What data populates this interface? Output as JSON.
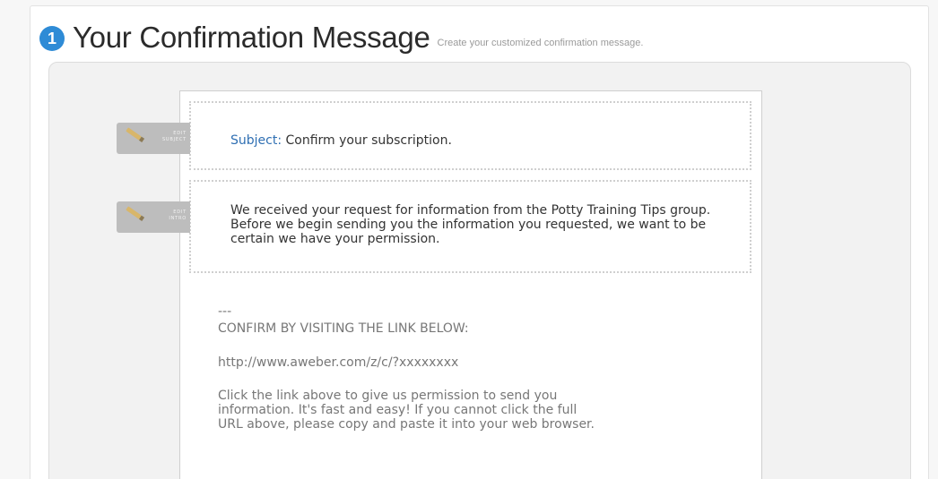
{
  "header": {
    "step_number": "1",
    "title": "Your Confirmation Message",
    "subtitle": "Create your customized confirmation message."
  },
  "edit_tabs": {
    "subject": [
      "EDIT",
      "SUBJECT"
    ],
    "intro": [
      "EDIT",
      "INTRO"
    ]
  },
  "message": {
    "subject_label": "Subject:",
    "subject_value": "Confirm your subscription.",
    "intro": "We received your request for information from the Potty Training Tips group. Before we begin sending you the information you requested, we want to be certain we have your permission.",
    "dashes": "---",
    "confirm_heading": "CONFIRM BY VISITING THE LINK BELOW:",
    "confirm_link": "http://www.aweber.com/z/c/?xxxxxxxx",
    "instructions": "Click the link above to give us permission to send you information. It's fast and easy! If you cannot click the full URL above, please copy and paste it into your web browser."
  },
  "colors": {
    "accent_blue": "#2e8bd6",
    "subject_label_blue": "#2f6fb3",
    "edit_tab_gray": "#bdbdbd"
  },
  "icons": [
    "step-number-icon",
    "pencil-icon"
  ]
}
